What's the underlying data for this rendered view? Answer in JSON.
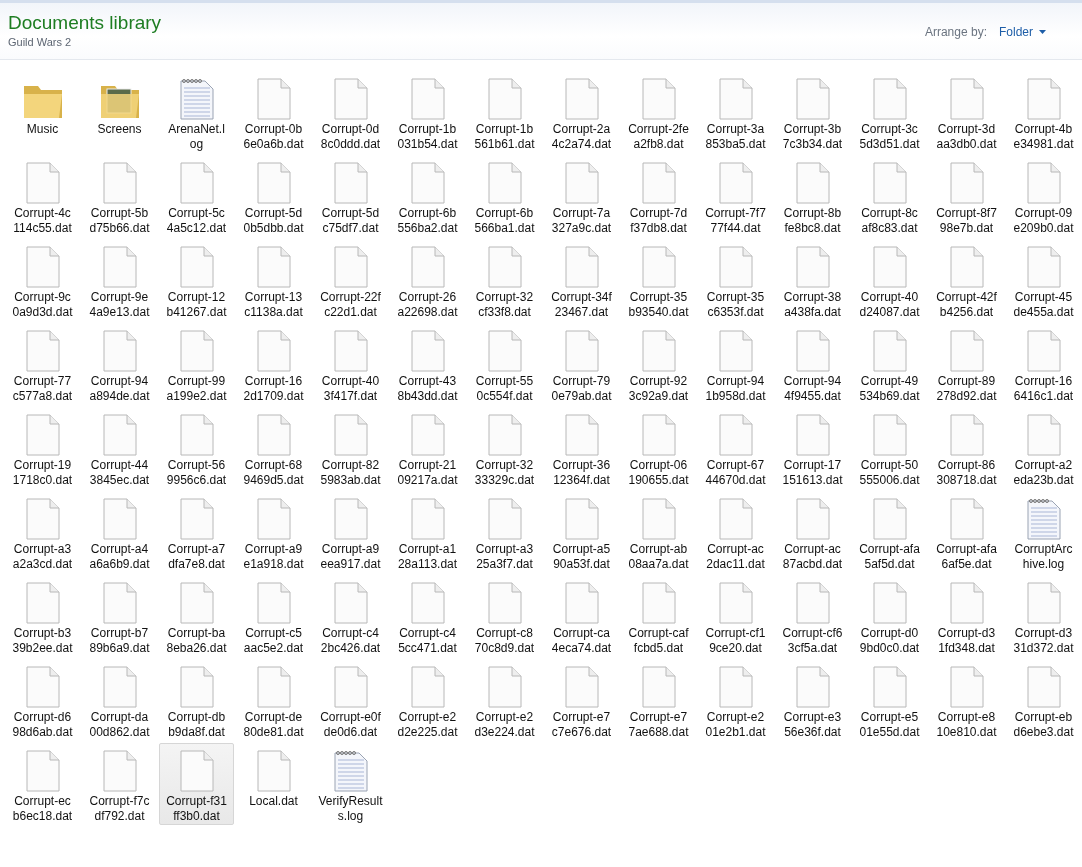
{
  "header": {
    "title": "Documents library",
    "subtitle": "Guild Wars 2",
    "arrange_label": "Arrange by:",
    "arrange_value": "Folder"
  },
  "items": [
    {
      "kind": "folder",
      "lines": [
        "Music"
      ],
      "selected": false
    },
    {
      "kind": "photo-folder",
      "lines": [
        "Screens"
      ],
      "selected": false
    },
    {
      "kind": "log",
      "lines": [
        "ArenaNet.l",
        "og"
      ],
      "selected": false
    },
    {
      "kind": "dat",
      "lines": [
        "Corrupt-0b",
        "6e0a6b.dat"
      ],
      "selected": false
    },
    {
      "kind": "dat",
      "lines": [
        "Corrupt-0d",
        "8c0ddd.dat"
      ],
      "selected": false
    },
    {
      "kind": "dat",
      "lines": [
        "Corrupt-1b",
        "031b54.dat"
      ],
      "selected": false
    },
    {
      "kind": "dat",
      "lines": [
        "Corrupt-1b",
        "561b61.dat"
      ],
      "selected": false
    },
    {
      "kind": "dat",
      "lines": [
        "Corrupt-2a",
        "4c2a74.dat"
      ],
      "selected": false
    },
    {
      "kind": "dat",
      "lines": [
        "Corrupt-2fe",
        "a2fb8.dat"
      ],
      "selected": false
    },
    {
      "kind": "dat",
      "lines": [
        "Corrupt-3a",
        "853ba5.dat"
      ],
      "selected": false
    },
    {
      "kind": "dat",
      "lines": [
        "Corrupt-3b",
        "7c3b34.dat"
      ],
      "selected": false
    },
    {
      "kind": "dat",
      "lines": [
        "Corrupt-3c",
        "5d3d51.dat"
      ],
      "selected": false
    },
    {
      "kind": "dat",
      "lines": [
        "Corrupt-3d",
        "aa3db0.dat"
      ],
      "selected": false
    },
    {
      "kind": "dat",
      "lines": [
        "Corrupt-4b",
        "e34981.dat"
      ],
      "selected": false
    },
    {
      "kind": "dat",
      "lines": [
        "Corrupt-4c",
        "114c55.dat"
      ],
      "selected": false
    },
    {
      "kind": "dat",
      "lines": [
        "Corrupt-5b",
        "d75b66.dat"
      ],
      "selected": false
    },
    {
      "kind": "dat",
      "lines": [
        "Corrupt-5c",
        "4a5c12.dat"
      ],
      "selected": false
    },
    {
      "kind": "dat",
      "lines": [
        "Corrupt-5d",
        "0b5dbb.dat"
      ],
      "selected": false
    },
    {
      "kind": "dat",
      "lines": [
        "Corrupt-5d",
        "c75df7.dat"
      ],
      "selected": false
    },
    {
      "kind": "dat",
      "lines": [
        "Corrupt-6b",
        "556ba2.dat"
      ],
      "selected": false
    },
    {
      "kind": "dat",
      "lines": [
        "Corrupt-6b",
        "566ba1.dat"
      ],
      "selected": false
    },
    {
      "kind": "dat",
      "lines": [
        "Corrupt-7a",
        "327a9c.dat"
      ],
      "selected": false
    },
    {
      "kind": "dat",
      "lines": [
        "Corrupt-7d",
        "f37db8.dat"
      ],
      "selected": false
    },
    {
      "kind": "dat",
      "lines": [
        "Corrupt-7f7",
        "77f44.dat"
      ],
      "selected": false
    },
    {
      "kind": "dat",
      "lines": [
        "Corrupt-8b",
        "fe8bc8.dat"
      ],
      "selected": false
    },
    {
      "kind": "dat",
      "lines": [
        "Corrupt-8c",
        "af8c83.dat"
      ],
      "selected": false
    },
    {
      "kind": "dat",
      "lines": [
        "Corrupt-8f7",
        "98e7b.dat"
      ],
      "selected": false
    },
    {
      "kind": "dat",
      "lines": [
        "Corrupt-09",
        "e209b0.dat"
      ],
      "selected": false
    },
    {
      "kind": "dat",
      "lines": [
        "Corrupt-9c",
        "0a9d3d.dat"
      ],
      "selected": false
    },
    {
      "kind": "dat",
      "lines": [
        "Corrupt-9e",
        "4a9e13.dat"
      ],
      "selected": false
    },
    {
      "kind": "dat",
      "lines": [
        "Corrupt-12",
        "b41267.dat"
      ],
      "selected": false
    },
    {
      "kind": "dat",
      "lines": [
        "Corrupt-13",
        "c1138a.dat"
      ],
      "selected": false
    },
    {
      "kind": "dat",
      "lines": [
        "Corrupt-22f",
        "c22d1.dat"
      ],
      "selected": false
    },
    {
      "kind": "dat",
      "lines": [
        "Corrupt-26",
        "a22698.dat"
      ],
      "selected": false
    },
    {
      "kind": "dat",
      "lines": [
        "Corrupt-32",
        "cf33f8.dat"
      ],
      "selected": false
    },
    {
      "kind": "dat",
      "lines": [
        "Corrupt-34f",
        "23467.dat"
      ],
      "selected": false
    },
    {
      "kind": "dat",
      "lines": [
        "Corrupt-35",
        "b93540.dat"
      ],
      "selected": false
    },
    {
      "kind": "dat",
      "lines": [
        "Corrupt-35",
        "c6353f.dat"
      ],
      "selected": false
    },
    {
      "kind": "dat",
      "lines": [
        "Corrupt-38",
        "a438fa.dat"
      ],
      "selected": false
    },
    {
      "kind": "dat",
      "lines": [
        "Corrupt-40",
        "d24087.dat"
      ],
      "selected": false
    },
    {
      "kind": "dat",
      "lines": [
        "Corrupt-42f",
        "b4256.dat"
      ],
      "selected": false
    },
    {
      "kind": "dat",
      "lines": [
        "Corrupt-45",
        "de455a.dat"
      ],
      "selected": false
    },
    {
      "kind": "dat",
      "lines": [
        "Corrupt-77",
        "c577a8.dat"
      ],
      "selected": false
    },
    {
      "kind": "dat",
      "lines": [
        "Corrupt-94",
        "a894de.dat"
      ],
      "selected": false
    },
    {
      "kind": "dat",
      "lines": [
        "Corrupt-99",
        "a199e2.dat"
      ],
      "selected": false
    },
    {
      "kind": "dat",
      "lines": [
        "Corrupt-16",
        "2d1709.dat"
      ],
      "selected": false
    },
    {
      "kind": "dat",
      "lines": [
        "Corrupt-40",
        "3f417f.dat"
      ],
      "selected": false
    },
    {
      "kind": "dat",
      "lines": [
        "Corrupt-43",
        "8b43dd.dat"
      ],
      "selected": false
    },
    {
      "kind": "dat",
      "lines": [
        "Corrupt-55",
        "0c554f.dat"
      ],
      "selected": false
    },
    {
      "kind": "dat",
      "lines": [
        "Corrupt-79",
        "0e79ab.dat"
      ],
      "selected": false
    },
    {
      "kind": "dat",
      "lines": [
        "Corrupt-92",
        "3c92a9.dat"
      ],
      "selected": false
    },
    {
      "kind": "dat",
      "lines": [
        "Corrupt-94",
        "1b958d.dat"
      ],
      "selected": false
    },
    {
      "kind": "dat",
      "lines": [
        "Corrupt-94",
        "4f9455.dat"
      ],
      "selected": false
    },
    {
      "kind": "dat",
      "lines": [
        "Corrupt-49",
        "534b69.dat"
      ],
      "selected": false
    },
    {
      "kind": "dat",
      "lines": [
        "Corrupt-89",
        "278d92.dat"
      ],
      "selected": false
    },
    {
      "kind": "dat",
      "lines": [
        "Corrupt-16",
        "6416c1.dat"
      ],
      "selected": false
    },
    {
      "kind": "dat",
      "lines": [
        "Corrupt-19",
        "1718c0.dat"
      ],
      "selected": false
    },
    {
      "kind": "dat",
      "lines": [
        "Corrupt-44",
        "3845ec.dat"
      ],
      "selected": false
    },
    {
      "kind": "dat",
      "lines": [
        "Corrupt-56",
        "9956c6.dat"
      ],
      "selected": false
    },
    {
      "kind": "dat",
      "lines": [
        "Corrupt-68",
        "9469d5.dat"
      ],
      "selected": false
    },
    {
      "kind": "dat",
      "lines": [
        "Corrupt-82",
        "5983ab.dat"
      ],
      "selected": false
    },
    {
      "kind": "dat",
      "lines": [
        "Corrupt-21",
        "09217a.dat"
      ],
      "selected": false
    },
    {
      "kind": "dat",
      "lines": [
        "Corrupt-32",
        "33329c.dat"
      ],
      "selected": false
    },
    {
      "kind": "dat",
      "lines": [
        "Corrupt-36",
        "12364f.dat"
      ],
      "selected": false
    },
    {
      "kind": "dat",
      "lines": [
        "Corrupt-06",
        "190655.dat"
      ],
      "selected": false
    },
    {
      "kind": "dat",
      "lines": [
        "Corrupt-67",
        "44670d.dat"
      ],
      "selected": false
    },
    {
      "kind": "dat",
      "lines": [
        "Corrupt-17",
        "151613.dat"
      ],
      "selected": false
    },
    {
      "kind": "dat",
      "lines": [
        "Corrupt-50",
        "555006.dat"
      ],
      "selected": false
    },
    {
      "kind": "dat",
      "lines": [
        "Corrupt-86",
        "308718.dat"
      ],
      "selected": false
    },
    {
      "kind": "dat",
      "lines": [
        "Corrupt-a2",
        "eda23b.dat"
      ],
      "selected": false
    },
    {
      "kind": "dat",
      "lines": [
        "Corrupt-a3",
        "a2a3cd.dat"
      ],
      "selected": false
    },
    {
      "kind": "dat",
      "lines": [
        "Corrupt-a4",
        "a6a6b9.dat"
      ],
      "selected": false
    },
    {
      "kind": "dat",
      "lines": [
        "Corrupt-a7",
        "dfa7e8.dat"
      ],
      "selected": false
    },
    {
      "kind": "dat",
      "lines": [
        "Corrupt-a9",
        "e1a918.dat"
      ],
      "selected": false
    },
    {
      "kind": "dat",
      "lines": [
        "Corrupt-a9",
        "eea917.dat"
      ],
      "selected": false
    },
    {
      "kind": "dat",
      "lines": [
        "Corrupt-a1",
        "28a113.dat"
      ],
      "selected": false
    },
    {
      "kind": "dat",
      "lines": [
        "Corrupt-a3",
        "25a3f7.dat"
      ],
      "selected": false
    },
    {
      "kind": "dat",
      "lines": [
        "Corrupt-a5",
        "90a53f.dat"
      ],
      "selected": false
    },
    {
      "kind": "dat",
      "lines": [
        "Corrupt-ab",
        "08aa7a.dat"
      ],
      "selected": false
    },
    {
      "kind": "dat",
      "lines": [
        "Corrupt-ac",
        "2dac11.dat"
      ],
      "selected": false
    },
    {
      "kind": "dat",
      "lines": [
        "Corrupt-ac",
        "87acbd.dat"
      ],
      "selected": false
    },
    {
      "kind": "dat",
      "lines": [
        "Corrupt-afa",
        "5af5d.dat"
      ],
      "selected": false
    },
    {
      "kind": "dat",
      "lines": [
        "Corrupt-afa",
        "6af5e.dat"
      ],
      "selected": false
    },
    {
      "kind": "log",
      "lines": [
        "CorruptArc",
        "hive.log"
      ],
      "selected": false
    },
    {
      "kind": "dat",
      "lines": [
        "Corrupt-b3",
        "39b2ee.dat"
      ],
      "selected": false
    },
    {
      "kind": "dat",
      "lines": [
        "Corrupt-b7",
        "89b6a9.dat"
      ],
      "selected": false
    },
    {
      "kind": "dat",
      "lines": [
        "Corrupt-ba",
        "8eba26.dat"
      ],
      "selected": false
    },
    {
      "kind": "dat",
      "lines": [
        "Corrupt-c5",
        "aac5e2.dat"
      ],
      "selected": false
    },
    {
      "kind": "dat",
      "lines": [
        "Corrupt-c4",
        "2bc426.dat"
      ],
      "selected": false
    },
    {
      "kind": "dat",
      "lines": [
        "Corrupt-c4",
        "5cc471.dat"
      ],
      "selected": false
    },
    {
      "kind": "dat",
      "lines": [
        "Corrupt-c8",
        "70c8d9.dat"
      ],
      "selected": false
    },
    {
      "kind": "dat",
      "lines": [
        "Corrupt-ca",
        "4eca74.dat"
      ],
      "selected": false
    },
    {
      "kind": "dat",
      "lines": [
        "Corrupt-caf",
        "fcbd5.dat"
      ],
      "selected": false
    },
    {
      "kind": "dat",
      "lines": [
        "Corrupt-cf1",
        "9ce20.dat"
      ],
      "selected": false
    },
    {
      "kind": "dat",
      "lines": [
        "Corrupt-cf6",
        "3cf5a.dat"
      ],
      "selected": false
    },
    {
      "kind": "dat",
      "lines": [
        "Corrupt-d0",
        "9bd0c0.dat"
      ],
      "selected": false
    },
    {
      "kind": "dat",
      "lines": [
        "Corrupt-d3",
        "1fd348.dat"
      ],
      "selected": false
    },
    {
      "kind": "dat",
      "lines": [
        "Corrupt-d3",
        "31d372.dat"
      ],
      "selected": false
    },
    {
      "kind": "dat",
      "lines": [
        "Corrupt-d6",
        "98d6ab.dat"
      ],
      "selected": false
    },
    {
      "kind": "dat",
      "lines": [
        "Corrupt-da",
        "00d862.dat"
      ],
      "selected": false
    },
    {
      "kind": "dat",
      "lines": [
        "Corrupt-db",
        "b9da8f.dat"
      ],
      "selected": false
    },
    {
      "kind": "dat",
      "lines": [
        "Corrupt-de",
        "80de81.dat"
      ],
      "selected": false
    },
    {
      "kind": "dat",
      "lines": [
        "Corrupt-e0f",
        "de0d6.dat"
      ],
      "selected": false
    },
    {
      "kind": "dat",
      "lines": [
        "Corrupt-e2",
        "d2e225.dat"
      ],
      "selected": false
    },
    {
      "kind": "dat",
      "lines": [
        "Corrupt-e2",
        "d3e224.dat"
      ],
      "selected": false
    },
    {
      "kind": "dat",
      "lines": [
        "Corrupt-e7",
        "c7e676.dat"
      ],
      "selected": false
    },
    {
      "kind": "dat",
      "lines": [
        "Corrupt-e7",
        "7ae688.dat"
      ],
      "selected": false
    },
    {
      "kind": "dat",
      "lines": [
        "Corrupt-e2",
        "01e2b1.dat"
      ],
      "selected": false
    },
    {
      "kind": "dat",
      "lines": [
        "Corrupt-e3",
        "56e36f.dat"
      ],
      "selected": false
    },
    {
      "kind": "dat",
      "lines": [
        "Corrupt-e5",
        "01e55d.dat"
      ],
      "selected": false
    },
    {
      "kind": "dat",
      "lines": [
        "Corrupt-e8",
        "10e810.dat"
      ],
      "selected": false
    },
    {
      "kind": "dat",
      "lines": [
        "Corrupt-eb",
        "d6ebe3.dat"
      ],
      "selected": false
    },
    {
      "kind": "dat",
      "lines": [
        "Corrupt-ec",
        "b6ec18.dat"
      ],
      "selected": false
    },
    {
      "kind": "dat",
      "lines": [
        "Corrupt-f7c",
        "df792.dat"
      ],
      "selected": false
    },
    {
      "kind": "dat",
      "lines": [
        "Corrupt-f31",
        "ff3b0.dat"
      ],
      "selected": true
    },
    {
      "kind": "dat",
      "lines": [
        "Local.dat"
      ],
      "selected": false
    },
    {
      "kind": "log",
      "lines": [
        "VerifyResult",
        "s.log"
      ],
      "selected": false
    }
  ]
}
